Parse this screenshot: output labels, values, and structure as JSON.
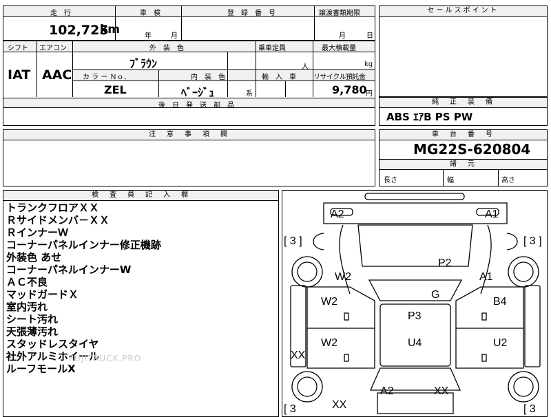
{
  "top": {
    "mileage_label": "走　行",
    "mileage": "102,725",
    "mileage_unit": "km",
    "inspection_label": "車　検",
    "year_label": "年",
    "month_label": "月",
    "registration_label": "登　録　番　号",
    "transfer_label": "譲渡書類期限",
    "transfer_month": "月",
    "transfer_day": "日"
  },
  "spec": {
    "shift_label": "シフト",
    "shift": "IAT",
    "ac_label": "エアコン",
    "ac": "AAC",
    "ext_color_label": "外　装　色",
    "ext_color": "ﾌﾞﾗｳﾝ",
    "capacity_label": "乗車定員",
    "capacity_unit": "人",
    "load_label": "最大積載量",
    "load_unit": "kg",
    "color_no_label": "カ ラ ー Ｎｏ．",
    "color_no": "ZEL",
    "interior_label": "内　装　色",
    "interior": "ﾍﾞｰｼﾞｭ",
    "interior_suffix": "系",
    "import_label": "輸　入　車",
    "recycle_label": "リサイクル預託金",
    "recycle": "9,780",
    "recycle_unit": "円",
    "later_parts_label": "後　日　発　送　部　品"
  },
  "selling": {
    "label": "セールスポイント"
  },
  "equipment": {
    "label": "純　正　装　備",
    "value": "ABS  ｴｱB  PS  PW"
  },
  "caution": {
    "label": "注　意　事　項　欄"
  },
  "chassis": {
    "label": "車　台　番　号",
    "value": "MG22S-620804"
  },
  "dims": {
    "label": "諸　元",
    "length": "長さ",
    "width": "幅",
    "height": "高さ"
  },
  "inspector": {
    "label": "検　査　員　記　入　欄",
    "notes": [
      "トランクフロアＸＸ",
      "Ｒサイドメンバ－ＸＸ",
      "ＲインナーＷ",
      "コーナーパネルインナー修正機跡",
      "外装色 あせ",
      "コーナーパネルインナーW",
      "ＡＣ不良",
      "マッドガードＸ",
      "室内汚れ",
      "シート汚れ",
      "天張薄汚れ",
      "スタッドレスタイヤ",
      "社外アルミホイール",
      "ルーフモールX"
    ],
    "watermark": "FUJITRUCK.PRO"
  },
  "diagram": {
    "marks": {
      "a2_top": "A2",
      "a1_top": "A1",
      "br_tl": "[ 3 ]",
      "br_tr": "[ 3 ]",
      "br_bl": "[ 3",
      "br_br": "[ 3",
      "p2": "P2",
      "w2_left": "W2",
      "a1_right": "A1",
      "g": "G",
      "w2_door1": "W2",
      "b4": "B4",
      "p3": "P3",
      "w2_door2": "W2",
      "u4": "U4",
      "u2": "U2",
      "xx_left": "XX",
      "a2_bottom": "A2",
      "xx_bottom": "XX",
      "xx_lower": "XX"
    }
  }
}
